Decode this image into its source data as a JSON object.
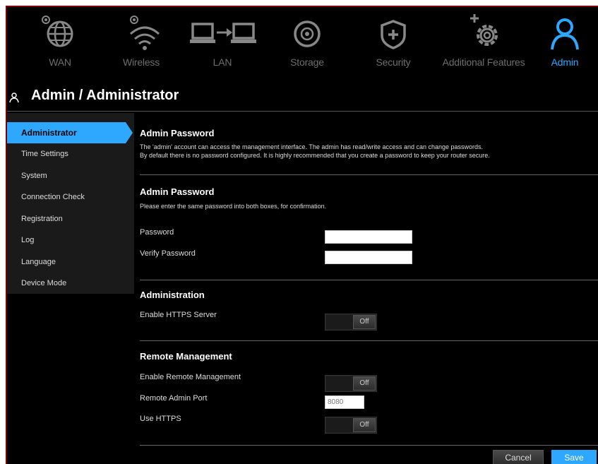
{
  "nav": {
    "items": [
      {
        "label": "WAN",
        "icon": "globe-icon"
      },
      {
        "label": "Wireless",
        "icon": "wifi-icon"
      },
      {
        "label": "LAN",
        "icon": "lan-icon"
      },
      {
        "label": "Storage",
        "icon": "disk-icon"
      },
      {
        "label": "Security",
        "icon": "shield-icon"
      },
      {
        "label": "Additional Features",
        "icon": "gear-plus-icon"
      },
      {
        "label": "Admin",
        "icon": "user-icon"
      }
    ],
    "active": "Admin"
  },
  "header": {
    "title": "Admin / Administrator"
  },
  "sidebar": {
    "items": [
      {
        "label": "Administrator"
      },
      {
        "label": "Time Settings"
      },
      {
        "label": "System"
      },
      {
        "label": "Connection Check"
      },
      {
        "label": "Registration"
      },
      {
        "label": "Log"
      },
      {
        "label": "Language"
      },
      {
        "label": "Device Mode"
      }
    ]
  },
  "sections": {
    "intro": {
      "title": "Admin Password",
      "line1": "The 'admin' account can access the management interface. The admin has read/write access and can change passwords.",
      "line2": "By default there is no password configured. It is highly recommended that you create a password to keep your router secure."
    },
    "password": {
      "title": "Admin Password",
      "desc": "Please enter the same password into both boxes, for confirmation.",
      "password_label": "Password",
      "password_value": "",
      "verify_label": "Verify Password",
      "verify_value": ""
    },
    "administration": {
      "title": "Administration",
      "https_label": "Enable HTTPS Server",
      "https_state": "Off"
    },
    "remote": {
      "title": "Remote Management",
      "enable_label": "Enable Remote Management",
      "enable_state": "Off",
      "port_label": "Remote Admin Port",
      "port_placeholder": "8080",
      "https_label": "Use HTTPS",
      "https_state": "Off"
    }
  },
  "buttons": {
    "cancel": "Cancel",
    "save": "Save"
  },
  "colors": {
    "accent": "#2ea8ff",
    "background": "#000000"
  }
}
